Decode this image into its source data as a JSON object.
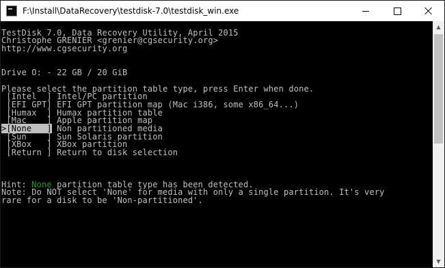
{
  "window": {
    "title": "F:\\Install\\DataRecovery\\testdisk-7.0\\testdisk_win.exe"
  },
  "console": {
    "header": [
      "TestDisk 7.0, Data Recovery Utility, April 2015",
      "Christophe GRENIER <grenier@cgsecurity.org>",
      "http://www.cgsecurity.org"
    ],
    "drive": "Drive O: - 22 GB / 20 GiB",
    "prompt": "Please select the partition table type, press Enter when done.",
    "menu": [
      {
        "prefix": " ",
        "key": "[Intel  ]",
        "desc": " Intel/PC partition",
        "selected": false
      },
      {
        "prefix": " ",
        "key": "[EFI GPT]",
        "desc": " EFI GPT partition map (Mac i386, some x86_64...)",
        "selected": false
      },
      {
        "prefix": " ",
        "key": "[Humax  ]",
        "desc": " Humax partition table",
        "selected": false
      },
      {
        "prefix": " ",
        "key": "[Mac    ]",
        "desc": " Apple partition map",
        "selected": false
      },
      {
        "prefix": ">",
        "key": "[None   ]",
        "desc": " Non partitioned media",
        "selected": true
      },
      {
        "prefix": " ",
        "key": "[Sun    ]",
        "desc": " Sun Solaris partition",
        "selected": false
      },
      {
        "prefix": " ",
        "key": "[XBox   ]",
        "desc": " XBox partition",
        "selected": false
      },
      {
        "prefix": " ",
        "key": "[Return ]",
        "desc": " Return to disk selection",
        "selected": false
      }
    ],
    "hint_prefix": "Hint: ",
    "hint_highlight": "None",
    "hint_suffix": " partition table type has been detected.",
    "note_line1": "Note: Do NOT select 'None' for media with only a single partition. It's very",
    "note_line2": "rare for a disk to be 'Non-partitioned'."
  },
  "colors": {
    "console_bg": "#000000",
    "console_fg": "#c0c0c0",
    "hint_green": "#13a10e",
    "selection_bg": "#c0c0c0"
  },
  "icons": {
    "app": "console-app-icon",
    "minimize": "minimize-icon",
    "maximize": "maximize-icon",
    "close": "close-icon",
    "scroll_up": "scroll-up-arrow-icon",
    "scroll_down": "scroll-down-arrow-icon"
  }
}
